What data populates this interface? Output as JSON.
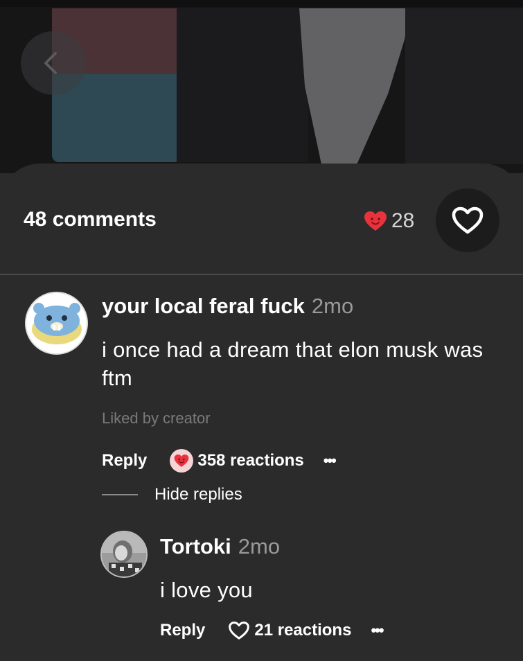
{
  "header": {
    "comments_label": "48 comments",
    "like_count": "28"
  },
  "comments": [
    {
      "author": "your local feral fuck",
      "time": "2mo",
      "text": "i once had a dream that elon musk was ftm",
      "liked_by": "Liked by creator",
      "reply_label": "Reply",
      "reactions_label": "358 reactions",
      "more_label": "•••",
      "hide_replies_label": "Hide replies"
    },
    {
      "author": "Tortoki",
      "time": "2mo",
      "text": "i love you",
      "reply_label": "Reply",
      "reactions_label": "21 reactions",
      "more_label": "•••"
    }
  ],
  "colors": {
    "background": "#2b2b2b",
    "heart_red": "#e8323c",
    "muted_text": "#9a9a9a"
  },
  "icons": [
    "back-chevron-icon",
    "heart-emoji-icon",
    "heart-outline-icon"
  ]
}
